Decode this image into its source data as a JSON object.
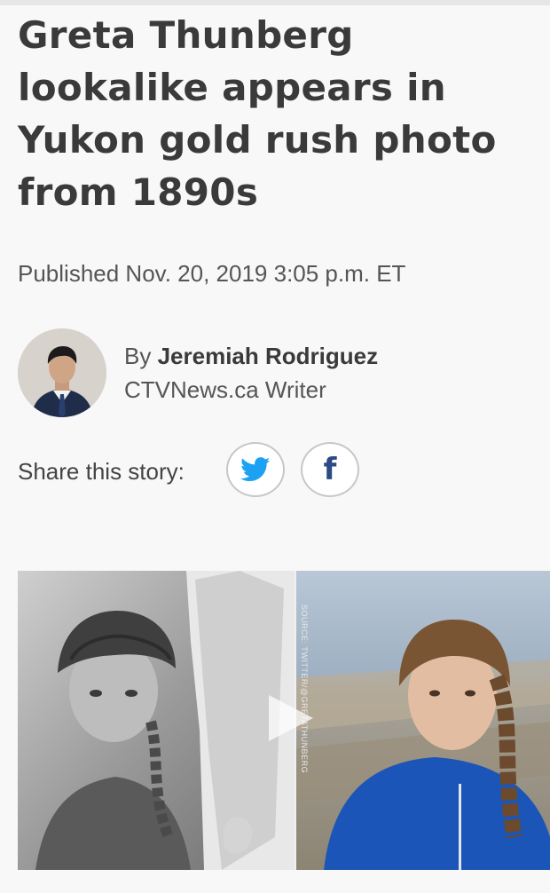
{
  "article": {
    "headline": "Greta Thunberg lookalike appears in Yukon gold rush photo from 1890s",
    "published": "Published Nov. 20, 2019 3:05 p.m. ET"
  },
  "author": {
    "by_label": "By",
    "name": "Jeremiah Rodriguez",
    "role": "CTVNews.ca Writer"
  },
  "share": {
    "label": "Share this story:",
    "buttons": [
      {
        "name": "twitter",
        "icon": "twitter-bird-icon",
        "color": "#1da1f2"
      },
      {
        "name": "facebook",
        "icon": "facebook-f-icon",
        "color": "#2b4a86",
        "glyph": "f"
      }
    ]
  },
  "media": {
    "source_credit": "SOURCE: TWITTER/@GRETATHUNBERG",
    "play_icon": "play-icon"
  }
}
